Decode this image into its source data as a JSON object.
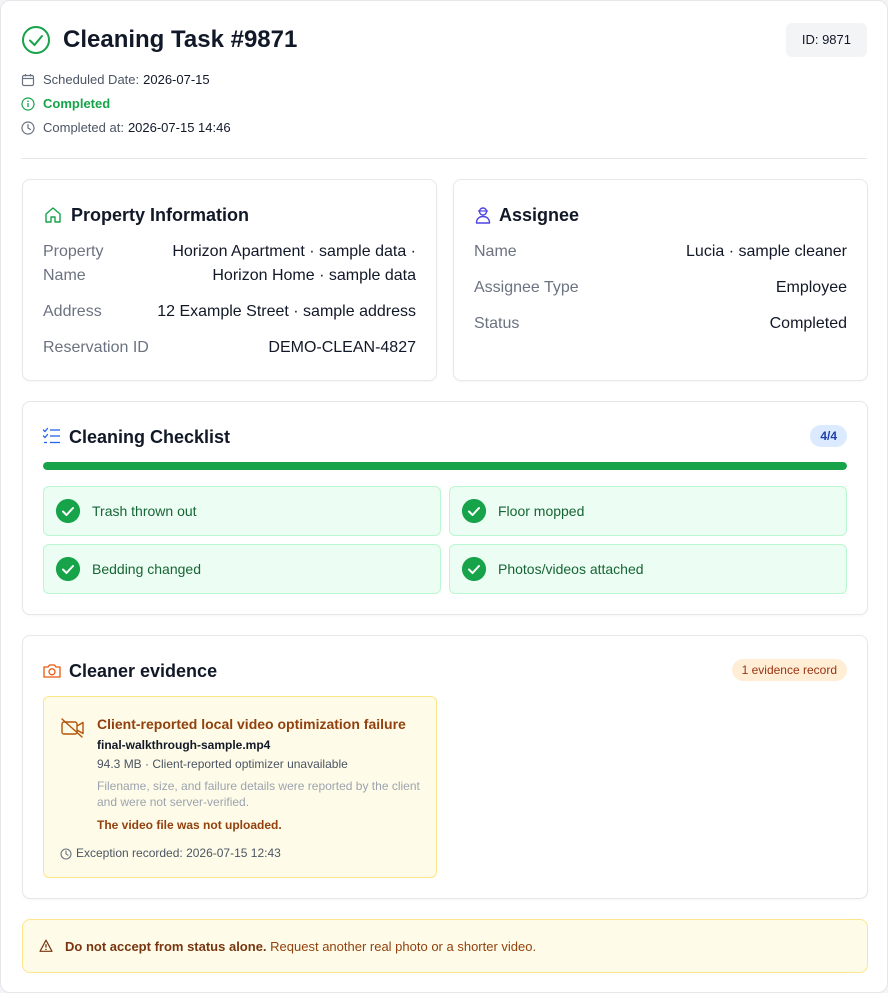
{
  "header": {
    "title": "Cleaning Task #9871",
    "id_badge": "ID: 9871",
    "scheduled_label": "Scheduled Date:",
    "scheduled_value": "2026-07-15",
    "status": "Completed",
    "completed_label": "Completed at:",
    "completed_value": "2026-07-15 14:46"
  },
  "property": {
    "title": "Property Information",
    "name_label_line1": "Property",
    "name_label_line2": "Name",
    "name_value_line1": "Horizon Apartment · sample data ·",
    "name_value_line2": "Horizon Home · sample data",
    "address_label": "Address",
    "address_value": "12 Example Street · sample address",
    "reservation_label": "Reservation ID",
    "reservation_value": "DEMO-CLEAN-4827"
  },
  "assignee": {
    "title": "Assignee",
    "name_label": "Name",
    "name_value": "Lucia · sample cleaner",
    "type_label": "Assignee Type",
    "type_value": "Employee",
    "status_label": "Status",
    "status_value": "Completed"
  },
  "checklist": {
    "title": "Cleaning Checklist",
    "count": "4/4",
    "progress": 1.0,
    "items": [
      {
        "label": "Trash thrown out"
      },
      {
        "label": "Floor mopped"
      },
      {
        "label": "Bedding changed"
      },
      {
        "label": "Photos/videos attached"
      }
    ]
  },
  "evidence": {
    "title": "Cleaner evidence",
    "badge": "1 evidence record",
    "record": {
      "title": "Client-reported local video optimization failure",
      "filename": "final-walkthrough-sample.mp4",
      "size_line": "94.3 MB · Client-reported optimizer unavailable",
      "note": "Filename, size, and failure details were reported by the client and were not server-verified.",
      "warning": "The video file was not uploaded.",
      "recorded": "Exception recorded: 2026-07-15 12:43"
    }
  },
  "alert": {
    "bold": "Do not accept from status alone.",
    "text": " Request another real photo or a shorter video."
  },
  "colors": {
    "success": "#16a34a",
    "warning_text": "#92400e",
    "badge_blue_bg": "#dbeafe",
    "badge_orange_bg": "#ffedd5"
  },
  "icons": {
    "title": "check-circle-icon",
    "scheduled": "calendar-icon",
    "status": "info-icon",
    "completed": "clock-icon",
    "property": "home-icon",
    "assignee": "user-icon",
    "checklist": "list-check-icon",
    "evidence": "camera-icon",
    "record": "video-off-icon",
    "alert": "warning-icon"
  }
}
